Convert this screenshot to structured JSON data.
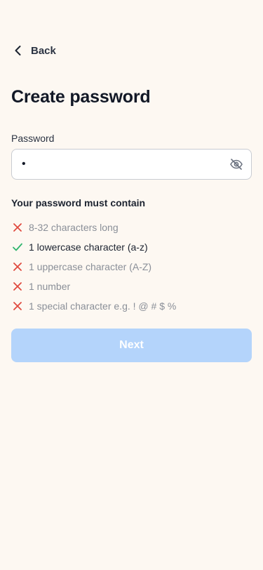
{
  "header": {
    "back_label": "Back",
    "back_icon": "chevron-left-icon"
  },
  "page": {
    "title": "Create password"
  },
  "password_field": {
    "label": "Password",
    "value": "a",
    "toggle_icon": "eye-off-icon"
  },
  "requirements": {
    "title": "Your password must contain",
    "items": [
      {
        "label": "8-32 characters long",
        "met": false
      },
      {
        "label": "1 lowercase character (a-z)",
        "met": true
      },
      {
        "label": "1 uppercase character (A-Z)",
        "met": false
      },
      {
        "label": "1 number",
        "met": false
      },
      {
        "label": "1 special character e.g. ! @ # $ %",
        "met": false
      }
    ]
  },
  "actions": {
    "next_label": "Next",
    "next_enabled": false
  },
  "colors": {
    "background": "#fdf8f2",
    "unmet": "#e04a3f",
    "met": "#2fb56d",
    "button_disabled": "#b4d4fb"
  }
}
